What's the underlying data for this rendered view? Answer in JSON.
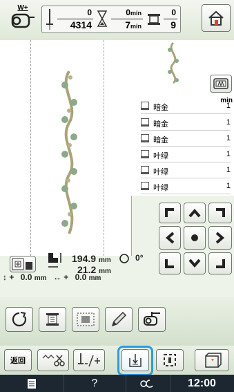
{
  "top": {
    "stitch_label": "W+",
    "stitch_current": "0",
    "stitch_total": "4314",
    "time_current": "0",
    "time_unit_current": "min",
    "time_total": "7",
    "time_unit_total": "min",
    "color_current": "0",
    "color_total": "9"
  },
  "thread_list": {
    "unit": "min",
    "rows": [
      {
        "name": "暗金",
        "time": "1"
      },
      {
        "name": "暗金",
        "time": "1"
      },
      {
        "name": "暗金",
        "time": "1"
      },
      {
        "name": "叶绿",
        "time": "1"
      },
      {
        "name": "叶绿",
        "time": "1"
      },
      {
        "name": "叶绿",
        "time": "1"
      }
    ]
  },
  "info": {
    "width_value": "194.9",
    "width_unit": "mm",
    "height_value": "21.2",
    "height_unit": "mm",
    "angle_value": "0",
    "angle_unit": "°",
    "offset_y_sign": "+",
    "offset_y_value": "0.0",
    "offset_y_unit": "mm",
    "offset_x_sign": "+",
    "offset_x_value": "0.0",
    "offset_x_unit": "mm"
  },
  "toolbar2": {
    "back_label": "返回"
  },
  "status": {
    "clock": "12:00",
    "help": "?"
  },
  "colors": {
    "accent": "#2a9de0",
    "statusbar": "#1d2731",
    "background": "#eef3ea"
  },
  "icons": [
    "presser-foot-icon",
    "needle-icon",
    "hourglass-icon",
    "spool-icon",
    "home-icon",
    "hoop-icon",
    "arrow-topleft-icon",
    "arrow-up-icon",
    "arrow-topright-icon",
    "arrow-left-icon",
    "center-dot-icon",
    "arrow-right-icon",
    "arrow-bottomleft-icon",
    "arrow-down-icon",
    "arrow-bottomright-icon",
    "rotate-icon",
    "thread-icon",
    "trial-icon",
    "pencil-icon",
    "foot-icon",
    "cut-icon",
    "needle-position-icon",
    "start-point-icon",
    "basting-icon",
    "page-icon",
    "help-icon",
    "stitch-icon"
  ]
}
